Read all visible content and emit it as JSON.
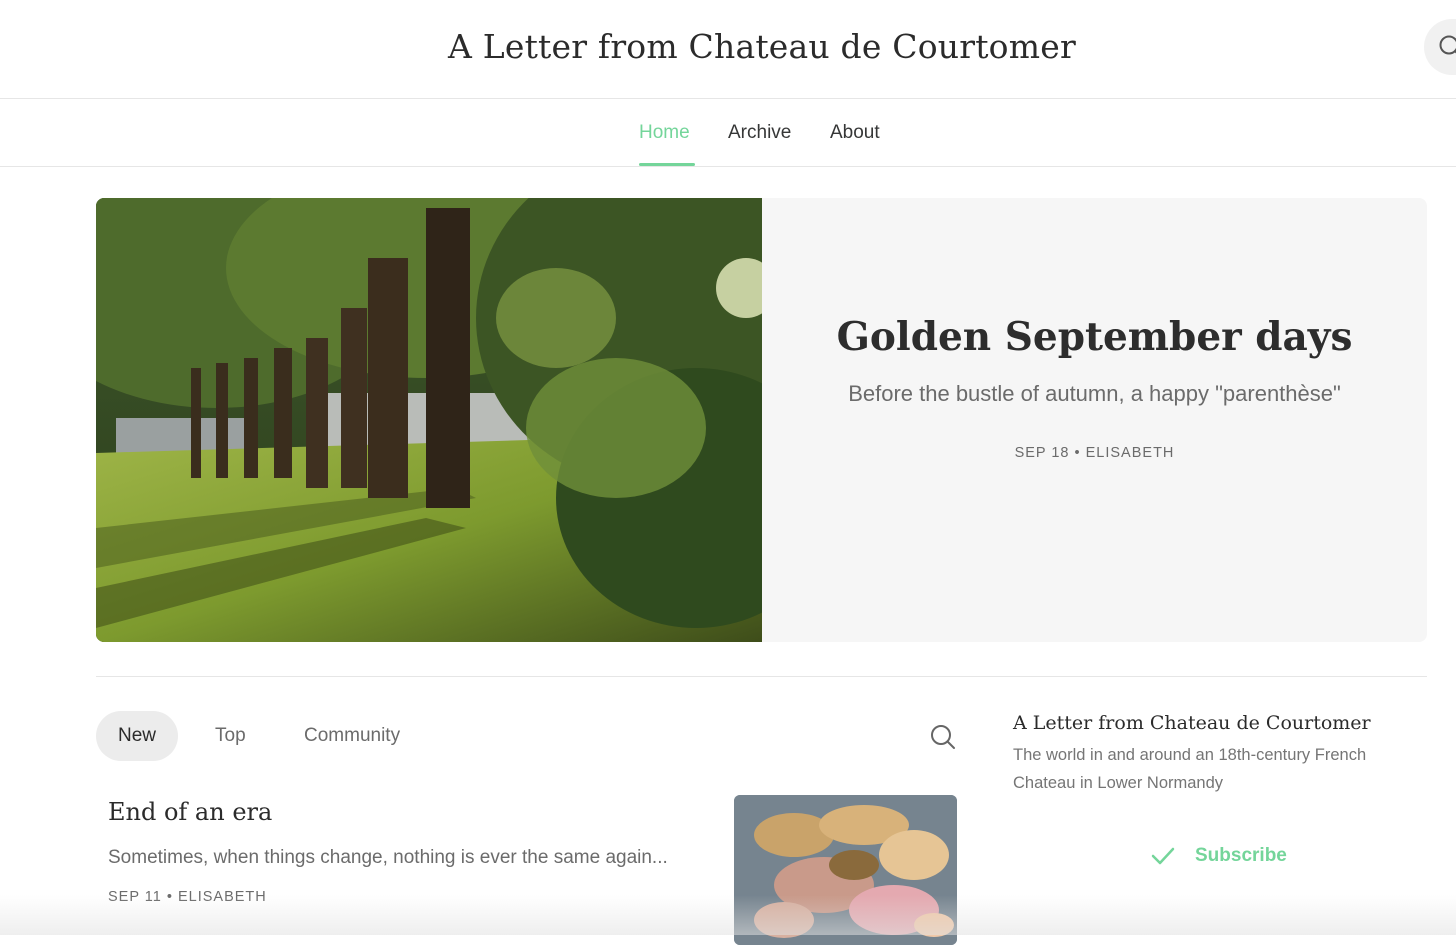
{
  "header": {
    "site_title": "A Letter from Chateau de Courtomer",
    "search_icon": "search-icon"
  },
  "nav": {
    "tabs": [
      {
        "label": "Home",
        "active": true
      },
      {
        "label": "Archive",
        "active": false
      },
      {
        "label": "About",
        "active": false
      }
    ]
  },
  "hero": {
    "title": "Golden September days",
    "subtitle": "Before the bustle of autumn, a happy \"parenthèse\"",
    "date": "SEP 18",
    "author": "ELISABETH",
    "meta": "SEP 18 • ELISABETH"
  },
  "feed": {
    "tabs": [
      {
        "label": "New",
        "active": true
      },
      {
        "label": "Top",
        "active": false
      },
      {
        "label": "Community",
        "active": false
      }
    ],
    "search_icon": "search-icon",
    "posts": [
      {
        "title": "End of an era",
        "subtitle": "Sometimes, when things change, nothing is ever the same again...",
        "meta": "SEP 11 • ELISABETH"
      }
    ]
  },
  "sidebar": {
    "title": "A Letter from Chateau de Courtomer",
    "description": "The world in and around an 18th-century French Chateau in Lower Normandy",
    "subscribe_label": "Subscribe",
    "subscribe_icon": "check-icon"
  },
  "colors": {
    "accent": "#74d59a",
    "text": "#363737",
    "muted": "#6b6b6b",
    "hero_bg": "#f6f6f6"
  }
}
